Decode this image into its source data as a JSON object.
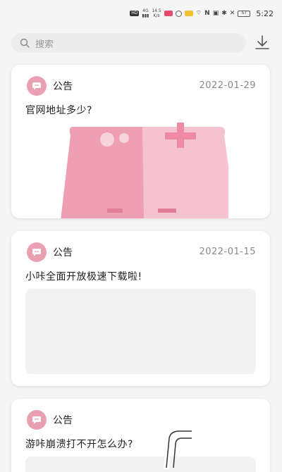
{
  "status_bar": {
    "network_speed_value": "14.5",
    "network_speed_unit": "K/s",
    "signal_label": "4G",
    "battery": "57",
    "time": "5:22"
  },
  "search": {
    "placeholder": "搜索"
  },
  "notices": [
    {
      "label": "公告",
      "date": "2022-01-29",
      "title": "官网地址多少?"
    },
    {
      "label": "公告",
      "date": "2022-01-15",
      "title": "小咔全面开放极速下载啦!"
    },
    {
      "label": "公告",
      "date": "",
      "title": "游咔崩溃打不开怎么办?"
    }
  ],
  "colors": {
    "accent_pink": "#e9a1b2",
    "background": "#f5f5f5",
    "card": "#ffffff"
  },
  "icons": {
    "search": "search-icon",
    "download": "download-icon",
    "notice": "message-icon",
    "gamepad": "gamepad-icon"
  }
}
